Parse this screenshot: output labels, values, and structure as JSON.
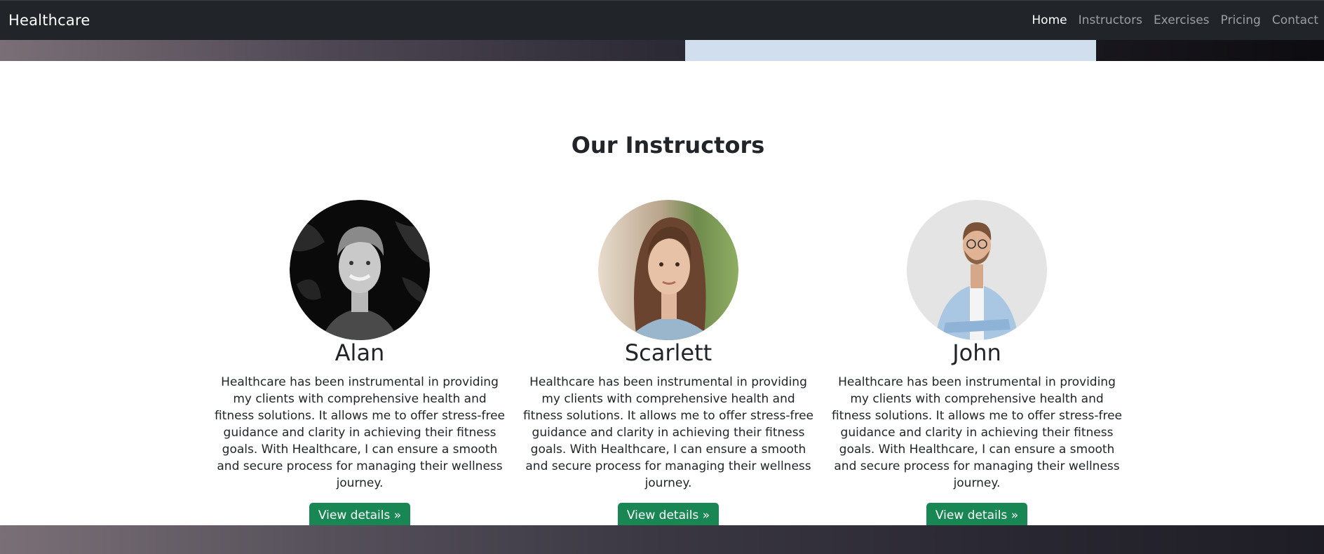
{
  "navbar": {
    "brand": "Healthcare",
    "links": [
      {
        "label": "Home",
        "active": true
      },
      {
        "label": "Instructors",
        "active": false
      },
      {
        "label": "Exercises",
        "active": false
      },
      {
        "label": "Pricing",
        "active": false
      },
      {
        "label": "Contact",
        "active": false
      }
    ]
  },
  "section": {
    "title": "Our Instructors"
  },
  "instructors": [
    {
      "name": "Alan",
      "description": "Healthcare has been instrumental in providing my clients with comprehensive health and fitness solutions. It allows me to offer stress-free guidance and clarity in achieving their fitness goals. With Healthcare, I can ensure a smooth and secure process for managing their wellness journey.",
      "button": "View details »"
    },
    {
      "name": "Scarlett",
      "description": "Healthcare has been instrumental in providing my clients with comprehensive health and fitness solutions. It allows me to offer stress-free guidance and clarity in achieving their fitness goals. With Healthcare, I can ensure a smooth and secure process for managing their wellness journey.",
      "button": "View details »"
    },
    {
      "name": "John",
      "description": "Healthcare has been instrumental in providing my clients with comprehensive health and fitness solutions. It allows me to offer stress-free guidance and clarity in achieving their fitness goals. With Healthcare, I can ensure a smooth and secure process for managing their wellness journey.",
      "button": "View details »"
    }
  ],
  "colors": {
    "navbar_bg": "#212529",
    "button_bg": "#198754",
    "hero_panel": "#d1deee"
  }
}
